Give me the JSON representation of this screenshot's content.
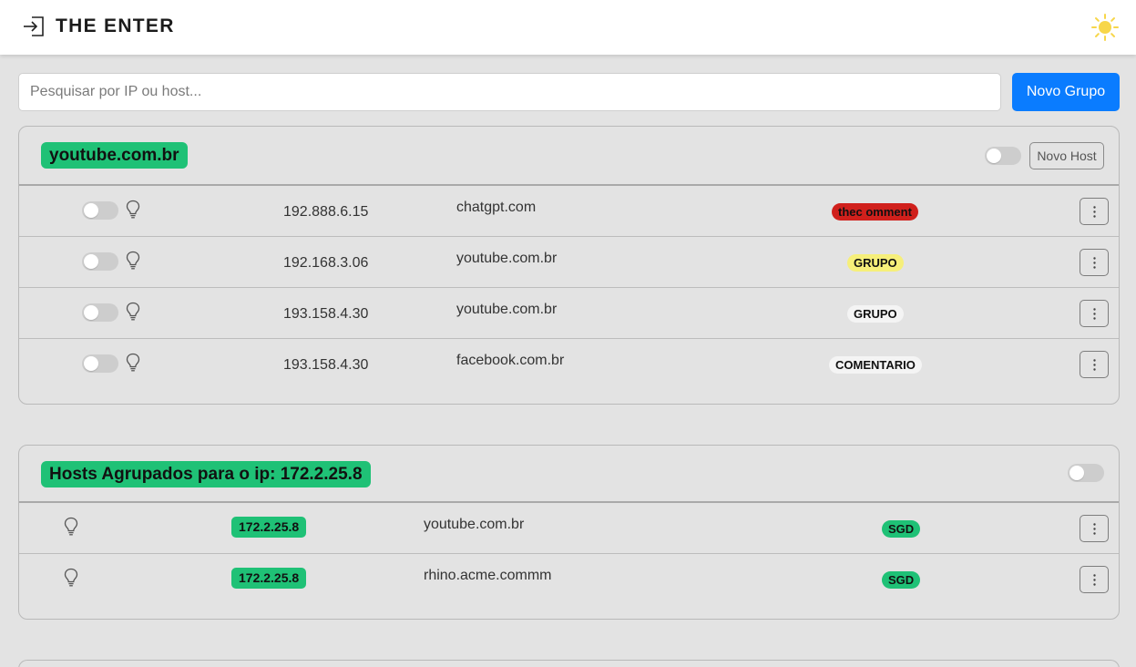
{
  "header": {
    "title": "THE ENTER",
    "brand_icon": "login-icon",
    "theme_icon": "sun-icon",
    "theme_color": "#f7d64a"
  },
  "toolbar": {
    "search_placeholder": "Pesquisar por IP ou host...",
    "new_group_label": "Novo Grupo",
    "accent": "#0a7cff"
  },
  "group1": {
    "title": "youtube.com.br",
    "title_color": "#1fc176",
    "new_host_label": "Novo Host",
    "rows": [
      {
        "ip": "192.888.6.15",
        "host": "chatgpt.com",
        "tag": "thec omment",
        "tag_color": "#d0201c"
      },
      {
        "ip": "192.168.3.06",
        "host": "youtube.com.br",
        "tag": "GRUPO",
        "tag_color": "#f6ef7a"
      },
      {
        "ip": "193.158.4.30",
        "host": "youtube.com.br",
        "tag": "GRUPO",
        "tag_color": "#f4f4f4"
      },
      {
        "ip": "193.158.4.30",
        "host": "facebook.com.br",
        "tag": "COMENTARIO",
        "tag_color": "#f4f4f4"
      }
    ]
  },
  "group2": {
    "title": "Hosts Agrupados para o ip: 172.2.25.8",
    "rows": [
      {
        "ip": "172.2.25.8",
        "host": "youtube.com.br",
        "tag": "SGD",
        "tag_color": "#1fc176"
      },
      {
        "ip": "172.2.25.8",
        "host": "rhino.acme.commm",
        "tag": "SGD",
        "tag_color": "#1fc176"
      }
    ]
  }
}
